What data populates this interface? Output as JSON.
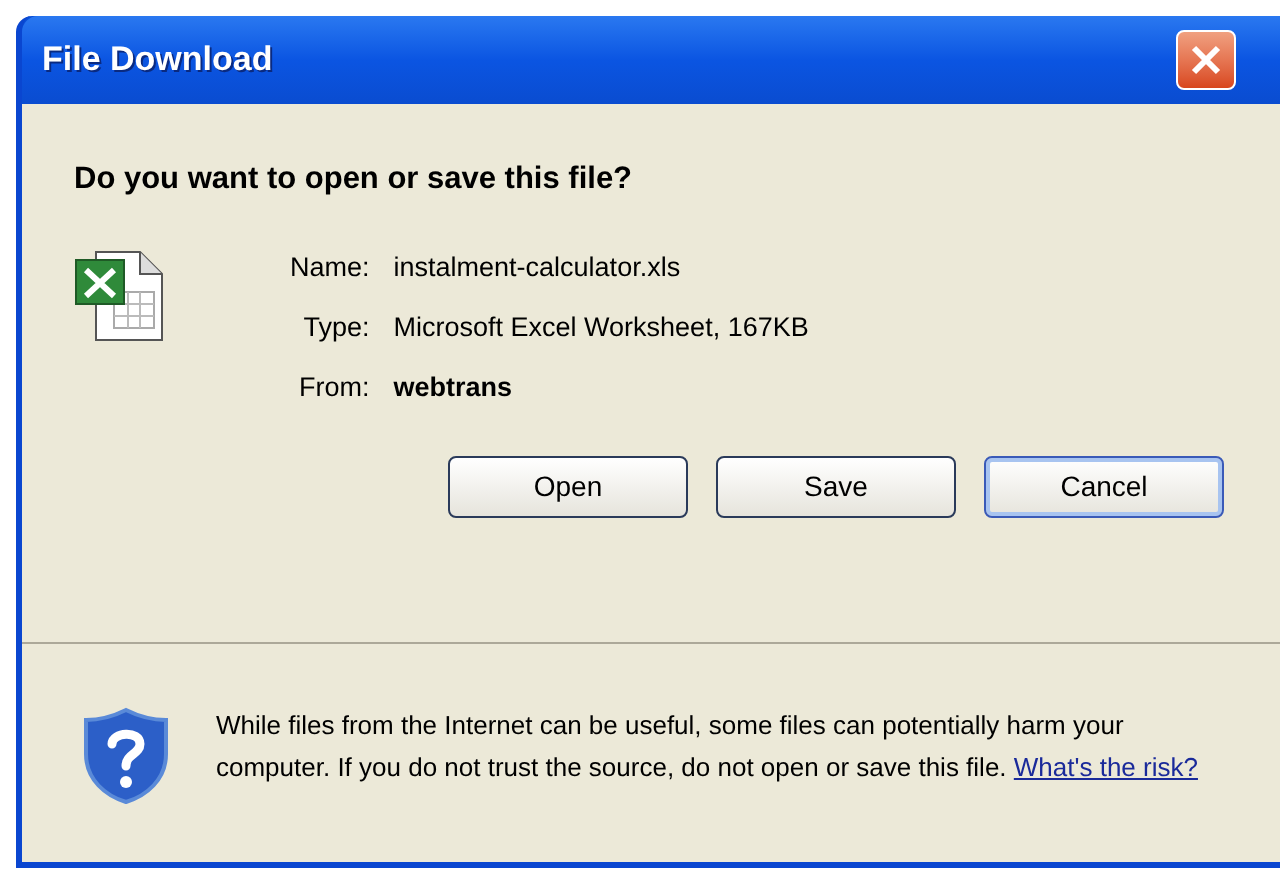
{
  "window": {
    "title": "File Download"
  },
  "question": "Do you want to open or save this file?",
  "details": [
    {
      "label": "Name:",
      "value": "instalment-calculator.xls",
      "bold": false
    },
    {
      "label": "Type:",
      "value": "Microsoft Excel Worksheet, 167KB",
      "bold": false
    },
    {
      "label": "From:",
      "value": "webtrans",
      "bold": true
    }
  ],
  "buttons": [
    {
      "label": "Open",
      "default": false
    },
    {
      "label": "Save",
      "default": false
    },
    {
      "label": "Cancel",
      "default": true
    }
  ],
  "warning": {
    "text": "While files from the Internet can be useful, some files can potentially harm your computer. If you do not trust the source, do not open or save this file.",
    "link": "What's the risk?"
  }
}
